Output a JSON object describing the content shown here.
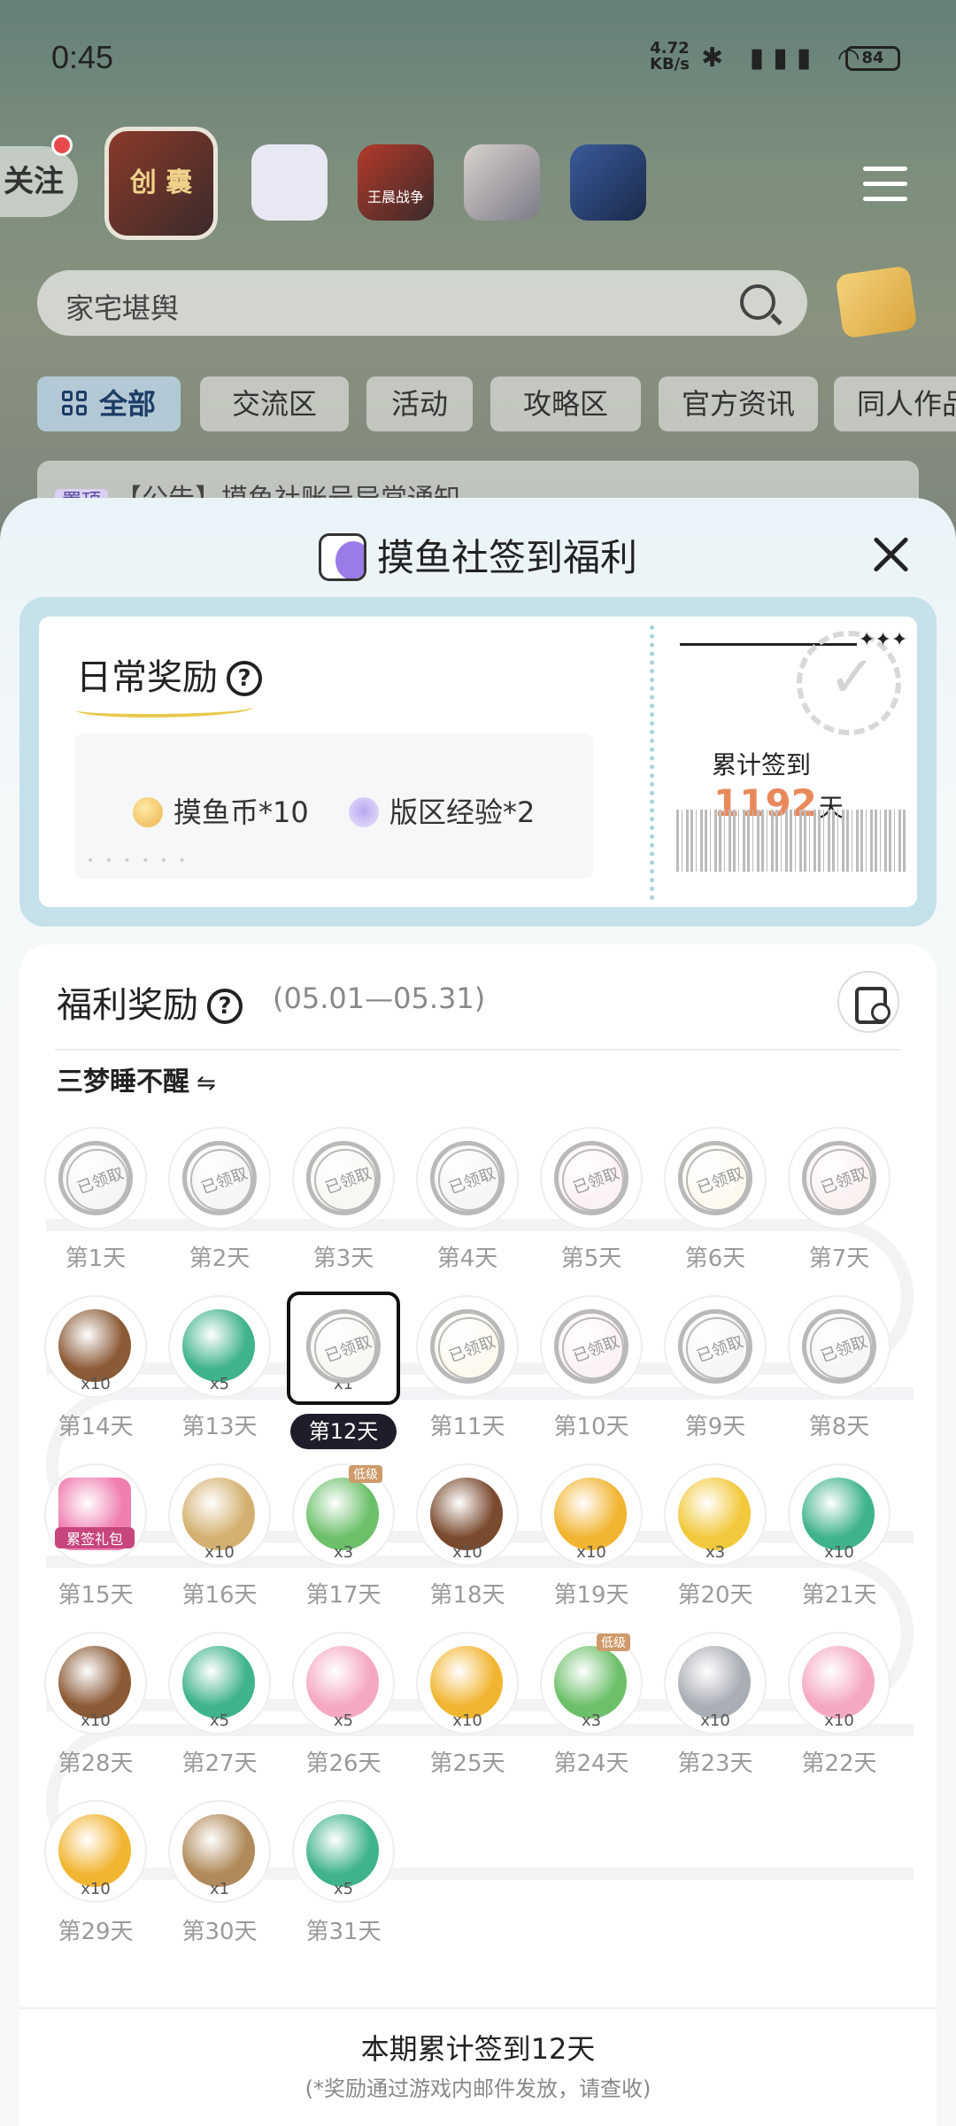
{
  "status_bar": {
    "time": "0:45",
    "net_speed": "4.72",
    "net_unit": "KB/s",
    "battery": "84",
    "icons": "✱ ▮▮▮ ◠"
  },
  "background": {
    "follow_label": "关注",
    "featured_game_label": "创 囊",
    "game_icons": [
      "fish-app-icon",
      "king-war-game-icon",
      "anime-girl-game-icon",
      "robot-game-icon"
    ],
    "king_war_label": "王晨战争",
    "search_text": "家宅堪舆",
    "tabs": [
      "全部",
      "交流区",
      "活动",
      "攻略区",
      "官方资讯",
      "同人作品"
    ],
    "notice_pin": "置顶",
    "notice_text": "【公告】摸鱼社账号异常通知"
  },
  "sheet": {
    "title": "摸鱼社签到福利",
    "daily": {
      "title": "日常奖励",
      "reward_coin": "摸鱼币*10",
      "reward_exp": "版区经验*2",
      "dots": "• • • • • •",
      "total_prefix": "累计签到",
      "total_days": "1192",
      "total_suffix": "天",
      "stars": "✦✦✦"
    },
    "welfare": {
      "title": "福利奖励",
      "period": "(05.01—05.31)",
      "username": "三梦睡不醒",
      "swap": "⇋",
      "claimed_text": "已领取",
      "summary": "本期累计签到12天",
      "note": "(*奖励通过游戏内邮件发放，请查收)"
    },
    "days": [
      {
        "label": "第1天",
        "claimed": true,
        "color": "#d9d9d9",
        "qty": ""
      },
      {
        "label": "第2天",
        "claimed": true,
        "color": "#d9d9d9",
        "qty": ""
      },
      {
        "label": "第3天",
        "claimed": true,
        "color": "#e6dfc8",
        "qty": ""
      },
      {
        "label": "第4天",
        "claimed": true,
        "color": "#d9d9d9",
        "qty": ""
      },
      {
        "label": "第5天",
        "claimed": true,
        "color": "#f4c8d8",
        "qty": ""
      },
      {
        "label": "第6天",
        "claimed": true,
        "color": "#f1e8c0",
        "qty": ""
      },
      {
        "label": "第7天",
        "claimed": true,
        "color": "#f0c8c8",
        "qty": ""
      },
      {
        "label": "第14天",
        "claimed": false,
        "color": "#8b5a36",
        "qty": "x10"
      },
      {
        "label": "第13天",
        "claimed": false,
        "color": "#3fb38a",
        "qty": "x5"
      },
      {
        "label": "第12天",
        "claimed": true,
        "color": "#e6dfc8",
        "qty": "x1",
        "current": true
      },
      {
        "label": "第11天",
        "claimed": true,
        "color": "#f1e8c0",
        "qty": ""
      },
      {
        "label": "第10天",
        "claimed": true,
        "color": "#f4c8d8",
        "qty": ""
      },
      {
        "label": "第9天",
        "claimed": true,
        "color": "#d9d9d9",
        "qty": ""
      },
      {
        "label": "第8天",
        "claimed": true,
        "color": "#d9d9d9",
        "qty": ""
      },
      {
        "label": "第15天",
        "claimed": false,
        "color": "#f07fb0",
        "qty": "",
        "gift": "累签礼包"
      },
      {
        "label": "第16天",
        "claimed": false,
        "color": "#d4b070",
        "qty": "x10"
      },
      {
        "label": "第17天",
        "claimed": false,
        "color": "#6cc06a",
        "qty": "x3",
        "badge": "低级"
      },
      {
        "label": "第18天",
        "claimed": false,
        "color": "#7a4a2e",
        "qty": "x10"
      },
      {
        "label": "第19天",
        "claimed": false,
        "color": "#f2b532",
        "qty": "x10"
      },
      {
        "label": "第20天",
        "claimed": false,
        "color": "#f2c93c",
        "qty": "x3"
      },
      {
        "label": "第21天",
        "claimed": false,
        "color": "#3fb38a",
        "qty": "x10"
      },
      {
        "label": "第28天",
        "claimed": false,
        "color": "#8b5a36",
        "qty": "x10"
      },
      {
        "label": "第27天",
        "claimed": false,
        "color": "#3fb38a",
        "qty": "x5"
      },
      {
        "label": "第26天",
        "claimed": false,
        "color": "#f5a9c0",
        "qty": "x5"
      },
      {
        "label": "第25天",
        "claimed": false,
        "color": "#f2b532",
        "qty": "x10"
      },
      {
        "label": "第24天",
        "claimed": false,
        "color": "#6cc06a",
        "qty": "x3",
        "badge": "低级"
      },
      {
        "label": "第23天",
        "claimed": false,
        "color": "#a9aeb5",
        "qty": "x10"
      },
      {
        "label": "第22天",
        "claimed": false,
        "color": "#f5a9c0",
        "qty": "x10"
      },
      {
        "label": "第29天",
        "claimed": false,
        "color": "#f2b532",
        "qty": "x10"
      },
      {
        "label": "第30天",
        "claimed": false,
        "color": "#b08a5a",
        "qty": "x1"
      },
      {
        "label": "第31天",
        "claimed": false,
        "color": "#3fb38a",
        "qty": "x5"
      }
    ]
  }
}
